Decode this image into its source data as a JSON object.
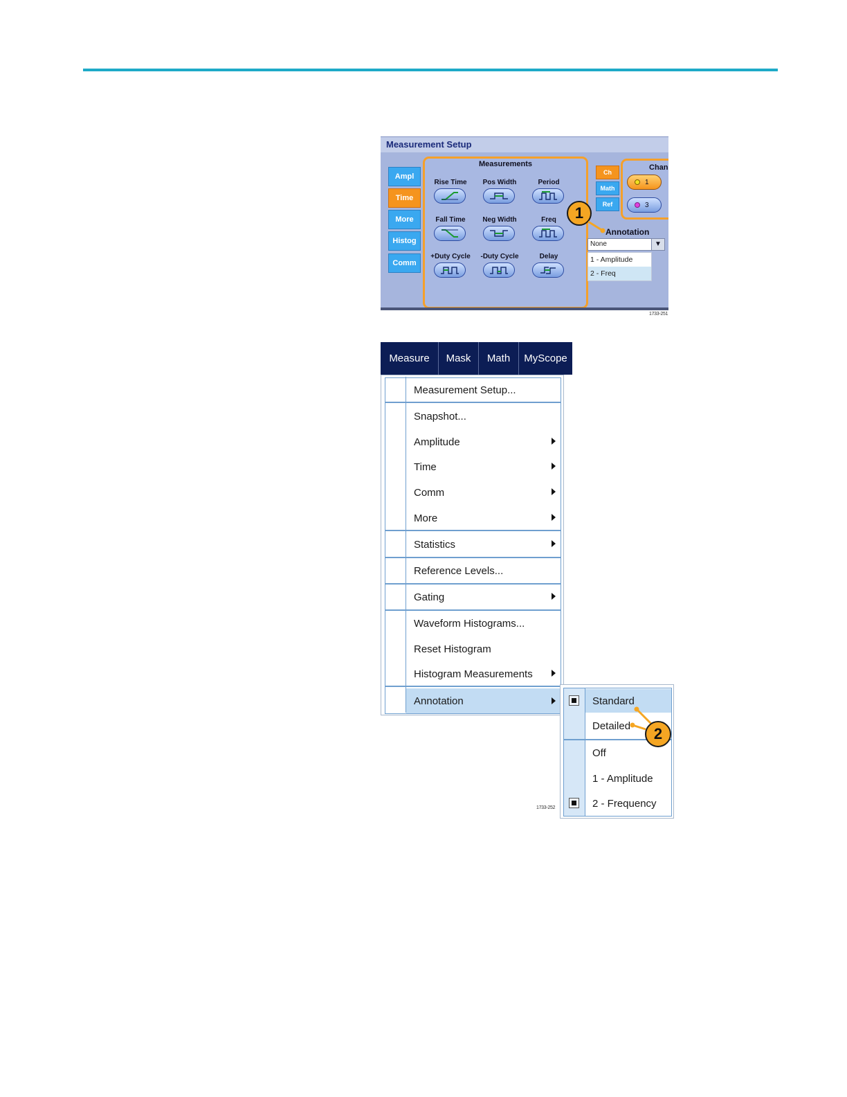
{
  "measurement_setup": {
    "title": "Measurement Setup",
    "left_tabs": [
      {
        "label": "Ampl",
        "active": false
      },
      {
        "label": "Time",
        "active": true
      },
      {
        "label": "More",
        "active": false
      },
      {
        "label": "Histog",
        "active": false
      },
      {
        "label": "Comm",
        "active": false
      }
    ],
    "measurements_title": "Measurements",
    "measurements": [
      {
        "label": "Rise Time",
        "icon": "rise-time-icon"
      },
      {
        "label": "Pos Width",
        "icon": "pos-width-icon"
      },
      {
        "label": "Period",
        "icon": "period-icon"
      },
      {
        "label": "Fall Time",
        "icon": "fall-time-icon"
      },
      {
        "label": "Neg Width",
        "icon": "neg-width-icon"
      },
      {
        "label": "Freq",
        "icon": "freq-icon"
      },
      {
        "label": "+Duty Cycle",
        "icon": "pos-duty-cycle-icon"
      },
      {
        "label": "-Duty Cycle",
        "icon": "neg-duty-cycle-icon"
      },
      {
        "label": "Delay",
        "icon": "delay-icon"
      }
    ],
    "source_tabs": [
      {
        "label": "Ch",
        "active": true
      },
      {
        "label": "Math",
        "active": false
      },
      {
        "label": "Ref",
        "active": false
      }
    ],
    "channel_title": "Chann",
    "channels": [
      {
        "label": "1",
        "color": "#f0e020",
        "selected": true
      },
      {
        "label": "3",
        "color": "#e040e0",
        "selected": false
      }
    ],
    "annotation_label": "Annotation",
    "annotation_value": "None",
    "annotation_options": [
      "1 - Amplitude",
      "2 - Freq"
    ],
    "callout": "1",
    "figure_code": "1733-251"
  },
  "menubar": [
    "Measure",
    "Mask",
    "Math",
    "MyScope"
  ],
  "menu": {
    "items": [
      {
        "label": "Measurement Setup...",
        "submenu": false
      },
      {
        "label": "Snapshot...",
        "submenu": false
      },
      {
        "label": "Amplitude",
        "submenu": true
      },
      {
        "label": "Time",
        "submenu": true
      },
      {
        "label": "Comm",
        "submenu": true
      },
      {
        "label": "More",
        "submenu": true
      },
      {
        "label": "Statistics",
        "submenu": true
      },
      {
        "label": "Reference Levels...",
        "submenu": false
      },
      {
        "label": "Gating",
        "submenu": true
      },
      {
        "label": "Waveform Histograms...",
        "submenu": false
      },
      {
        "label": "Reset Histogram",
        "submenu": false
      },
      {
        "label": "Histogram Measurements",
        "submenu": true
      },
      {
        "label": "Annotation",
        "submenu": true
      }
    ]
  },
  "submenu": {
    "items": [
      {
        "label": "Standard",
        "checked": true
      },
      {
        "label": "Detailed",
        "checked": false
      },
      {
        "label": "Off",
        "checked": false
      },
      {
        "label": "1 - Amplitude",
        "checked": false
      },
      {
        "label": "2 - Frequency",
        "checked": true
      }
    ],
    "callout": "2",
    "figure_code": "1733-252"
  },
  "colors": {
    "rule": "#1eaac8",
    "tab_active": "#f5941e",
    "tab": "#3aa8f0",
    "callout": "#f5a623",
    "menubar": "#0c1d55"
  }
}
